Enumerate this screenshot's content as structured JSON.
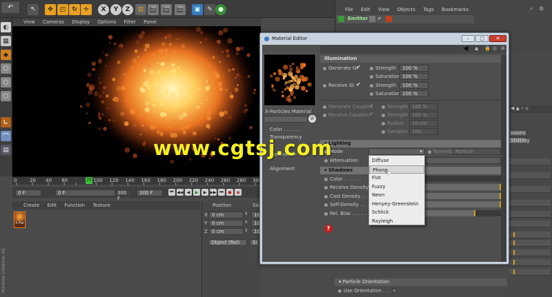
{
  "toolbar": {
    "axis_x": "X",
    "axis_y": "Y",
    "axis_z": "Z"
  },
  "om": {
    "menu": [
      "File",
      "Edit",
      "View",
      "Objects",
      "Tags",
      "Bookmarks"
    ],
    "object_name": "Emitter"
  },
  "viewport": {
    "menu": [
      "View",
      "Cameras",
      "Display",
      "Options",
      "Filter",
      "Panel"
    ]
  },
  "timeline": {
    "ticks": [
      "0",
      "20",
      "40",
      "60",
      "75",
      "100",
      "120",
      "140",
      "160",
      "180",
      "200",
      "220",
      "240",
      "260",
      "280",
      "300"
    ],
    "current": "75",
    "frame_start": "0 F",
    "frame_field": "0 F",
    "frame_end_a": "300 F",
    "frame_end_b": "300 F"
  },
  "material_manager": {
    "menu": [
      "Create",
      "Edit",
      "Function",
      "Texture"
    ],
    "material_label": "X-Par"
  },
  "coord": {
    "title": "Position",
    "size_short": "Siz",
    "rows": [
      {
        "axis": "X",
        "value": "0 cm",
        "trail": "10"
      },
      {
        "axis": "Y",
        "value": "0 cm",
        "trail": "10"
      },
      {
        "axis": "Z",
        "value": "0 cm",
        "trail": "10"
      }
    ],
    "mode": "Object (Rel)",
    "apply_short": "Si"
  },
  "editor": {
    "title": "Material Editor",
    "material_name": "X-Particles Material",
    "channels": [
      "Color . . . . . .",
      "Transparency",
      "Luminance",
      "Alignment"
    ],
    "illumination": {
      "header": "Illumination",
      "generate_gi": "Generate GI",
      "receive_gi": "Receive GI",
      "strength": "Strength",
      "saturation": "Saturation",
      "strength_val": "100 %",
      "saturation_val": "100 %",
      "generate_caustics": "Generate Caustics",
      "receive_caustics": "Receive Caustics",
      "radius": "Radius",
      "radius_val": "10 cm",
      "samples": "Samples",
      "samples_val": "100"
    },
    "lighting": {
      "header": "Lighting",
      "mode_short": "Mode",
      "normals": "Normals",
      "normals_val": "Particle",
      "attenuation": "Attenuation"
    },
    "shadows": {
      "header": "Shadows",
      "color": "Color . . . . . .",
      "receive_density": "Receive Density",
      "cast_density": "Cast Density . .",
      "self_density": "Self-Density . .",
      "rel_bias": "Rel. Bias . . . . ."
    },
    "dropdown": [
      "Diffuse",
      "Phong",
      "Flat",
      "Fuzzy",
      "Neon",
      "Henyey-Greenstein",
      "Schlick",
      "Rayleigh"
    ],
    "dropdown_selected": "Phong"
  },
  "right_panel": {
    "tab_a": "ssions",
    "tab_b": "Shitting",
    "section": "Particle Orientation",
    "use_orientation": "Use Orientation . . . ."
  },
  "watermark": "www.cgtsj.com",
  "brand": "MAXON CINEMA 4D"
}
